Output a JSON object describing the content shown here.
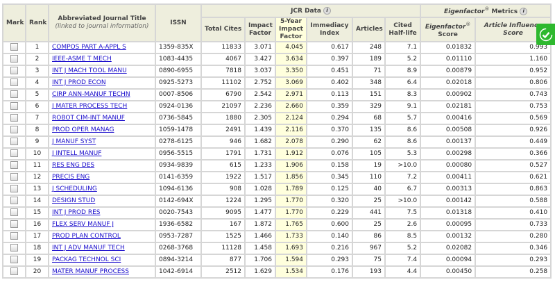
{
  "header": {
    "mark": "Mark",
    "rank": "Rank",
    "title": "Abbreviated Journal Title",
    "title_sub": "(linked to journal information)",
    "issn": "ISSN",
    "jcr_group": "JCR Data",
    "eigen_group_name": "Eigenfactor",
    "eigen_group_rest": " Metrics",
    "registered": "®",
    "info": "i",
    "total_cites": "Total Cites",
    "impact_factor": "Impact Factor",
    "five_year": "5-Year Impact Factor",
    "immediacy": "Immediacy Index",
    "articles": "Articles",
    "half_life": "Cited Half-life",
    "eigen_score_name": "Eigenfactor",
    "eigen_score_rest": "Score",
    "ai_score": "Article Influence Score"
  },
  "rows": [
    {
      "rank": "1",
      "title": "COMPOS PART A-APPL S",
      "issn": "1359-835X",
      "cites": "11833",
      "if": "3.071",
      "if5": "4.045",
      "imm": "0.617",
      "art": "248",
      "hl": "7.1",
      "ef": "0.01832",
      "ai": "0.993"
    },
    {
      "rank": "2",
      "title": "IEEE-ASME T MECH",
      "issn": "1083-4435",
      "cites": "4067",
      "if": "3.427",
      "if5": "3.634",
      "imm": "0.397",
      "art": "189",
      "hl": "5.2",
      "ef": "0.01110",
      "ai": "1.160"
    },
    {
      "rank": "3",
      "title": "INT J MACH TOOL MANU",
      "issn": "0890-6955",
      "cites": "7818",
      "if": "3.037",
      "if5": "3.350",
      "imm": "0.451",
      "art": "71",
      "hl": "8.9",
      "ef": "0.00879",
      "ai": "0.952"
    },
    {
      "rank": "4",
      "title": "INT J PROD ECON",
      "issn": "0925-5273",
      "cites": "11102",
      "if": "2.752",
      "if5": "3.069",
      "imm": "0.402",
      "art": "348",
      "hl": "6.4",
      "ef": "0.02018",
      "ai": "0.806"
    },
    {
      "rank": "5",
      "title": "CIRP ANN-MANUF TECHN",
      "issn": "0007-8506",
      "cites": "6790",
      "if": "2.542",
      "if5": "2.971",
      "imm": "0.113",
      "art": "151",
      "hl": "8.3",
      "ef": "0.00902",
      "ai": "0.743"
    },
    {
      "rank": "6",
      "title": "J MATER PROCESS TECH",
      "issn": "0924-0136",
      "cites": "21097",
      "if": "2.236",
      "if5": "2.660",
      "imm": "0.359",
      "art": "329",
      "hl": "9.1",
      "ef": "0.02181",
      "ai": "0.753"
    },
    {
      "rank": "7",
      "title": "ROBOT CIM-INT MANUF",
      "issn": "0736-5845",
      "cites": "1880",
      "if": "2.305",
      "if5": "2.124",
      "imm": "0.294",
      "art": "68",
      "hl": "5.7",
      "ef": "0.00416",
      "ai": "0.569"
    },
    {
      "rank": "8",
      "title": "PROD OPER MANAG",
      "issn": "1059-1478",
      "cites": "2491",
      "if": "1.439",
      "if5": "2.116",
      "imm": "0.370",
      "art": "135",
      "hl": "8.6",
      "ef": "0.00508",
      "ai": "0.926"
    },
    {
      "rank": "9",
      "title": "J MANUF SYST",
      "issn": "0278-6125",
      "cites": "946",
      "if": "1.682",
      "if5": "2.078",
      "imm": "0.290",
      "art": "62",
      "hl": "8.6",
      "ef": "0.00137",
      "ai": "0.449"
    },
    {
      "rank": "10",
      "title": "J INTELL MANUF",
      "issn": "0956-5515",
      "cites": "1791",
      "if": "1.731",
      "if5": "1.912",
      "imm": "0.076",
      "art": "105",
      "hl": "5.3",
      "ef": "0.00298",
      "ai": "0.366"
    },
    {
      "rank": "11",
      "title": "RES ENG DES",
      "issn": "0934-9839",
      "cites": "615",
      "if": "1.233",
      "if5": "1.906",
      "imm": "0.158",
      "art": "19",
      "hl": ">10.0",
      "ef": "0.00080",
      "ai": "0.527"
    },
    {
      "rank": "12",
      "title": "PRECIS ENG",
      "issn": "0141-6359",
      "cites": "1922",
      "if": "1.517",
      "if5": "1.856",
      "imm": "0.345",
      "art": "110",
      "hl": "7.2",
      "ef": "0.00411",
      "ai": "0.621"
    },
    {
      "rank": "13",
      "title": "J SCHEDULING",
      "issn": "1094-6136",
      "cites": "908",
      "if": "1.028",
      "if5": "1.789",
      "imm": "0.125",
      "art": "40",
      "hl": "6.7",
      "ef": "0.00313",
      "ai": "0.863"
    },
    {
      "rank": "14",
      "title": "DESIGN STUD",
      "issn": "0142-694X",
      "cites": "1224",
      "if": "1.295",
      "if5": "1.770",
      "imm": "0.320",
      "art": "25",
      "hl": ">10.0",
      "ef": "0.00142",
      "ai": "0.588"
    },
    {
      "rank": "15",
      "title": "INT J PROD RES",
      "issn": "0020-7543",
      "cites": "9095",
      "if": "1.477",
      "if5": "1.770",
      "imm": "0.229",
      "art": "441",
      "hl": "7.5",
      "ef": "0.01318",
      "ai": "0.410"
    },
    {
      "rank": "16",
      "title": "FLEX SERV MANUF J",
      "issn": "1936-6582",
      "cites": "167",
      "if": "1.872",
      "if5": "1.765",
      "imm": "0.600",
      "art": "25",
      "hl": "2.6",
      "ef": "0.00095",
      "ai": "0.733"
    },
    {
      "rank": "17",
      "title": "PROD PLAN CONTROL",
      "issn": "0953-7287",
      "cites": "1525",
      "if": "1.466",
      "if5": "1.733",
      "imm": "0.140",
      "art": "86",
      "hl": "8.5",
      "ef": "0.00132",
      "ai": "0.280"
    },
    {
      "rank": "18",
      "title": "INT J ADV MANUF TECH",
      "issn": "0268-3768",
      "cites": "11128",
      "if": "1.458",
      "if5": "1.693",
      "imm": "0.216",
      "art": "967",
      "hl": "5.2",
      "ef": "0.02082",
      "ai": "0.346"
    },
    {
      "rank": "19",
      "title": "PACKAG TECHNOL SCI",
      "issn": "0894-3214",
      "cites": "877",
      "if": "1.706",
      "if5": "1.594",
      "imm": "0.293",
      "art": "75",
      "hl": "7.4",
      "ef": "0.00094",
      "ai": "0.293"
    },
    {
      "rank": "20",
      "title": "MATER MANUF PROCESS",
      "issn": "1042-6914",
      "cites": "2512",
      "if": "1.629",
      "if5": "1.534",
      "imm": "0.176",
      "art": "193",
      "hl": "4.4",
      "ef": "0.00450",
      "ai": "0.258"
    }
  ],
  "colors": {
    "header_bg": "#eeeedd",
    "highlight_col": "#ffffdd",
    "link": "#1a0dcc",
    "badge": "#2eb82e"
  }
}
